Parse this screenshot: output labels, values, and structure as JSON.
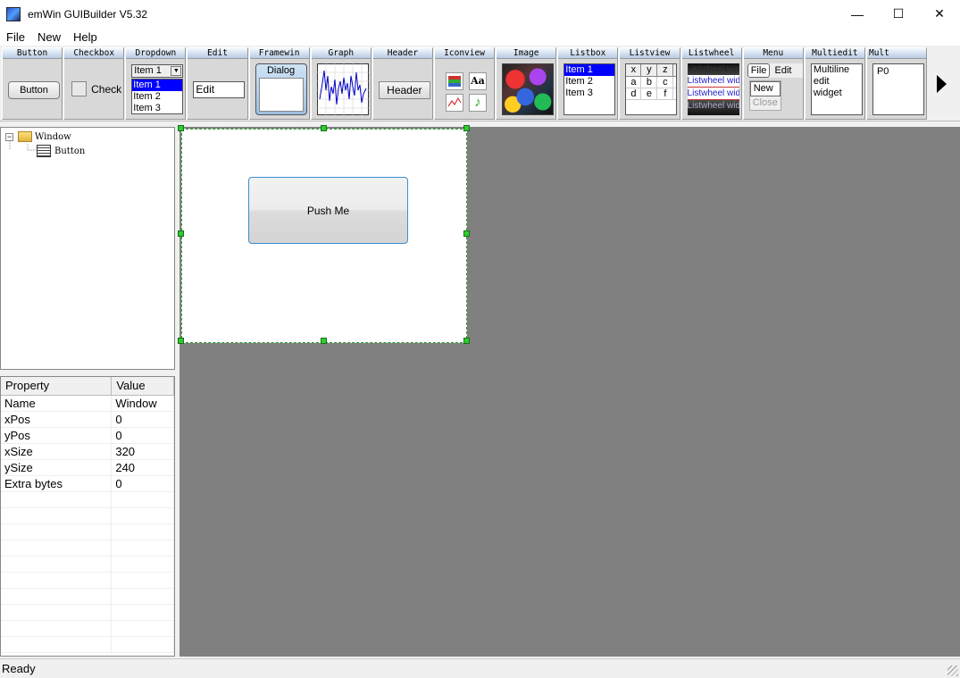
{
  "window": {
    "title": "emWin GUIBuilder V5.32",
    "controls": {
      "minimize": "—",
      "maximize": "☐",
      "close": "✕"
    }
  },
  "menubar": {
    "items": [
      "File",
      "New",
      "Help"
    ]
  },
  "palette": {
    "labels": {
      "button": "Button",
      "checkbox": "Checkbox",
      "dropdown": "Dropdown",
      "edit": "Edit",
      "framewin": "Framewin",
      "graph": "Graph",
      "header": "Header",
      "iconview": "Iconview",
      "image": "Image",
      "listbox": "Listbox",
      "listview": "Listview",
      "listwheel": "Listwheel",
      "menu": "Menu",
      "multiedit": "Multiedit",
      "multipage": "Mult"
    },
    "button_sample": "Button",
    "checkbox_sample": "Check",
    "dropdown": {
      "selected": "Item 1",
      "items": [
        "Item 1",
        "Item 2",
        "Item 3"
      ]
    },
    "edit_sample": "Edit",
    "framewin_sample": "Dialog",
    "header_sample": "Header",
    "listbox_items": [
      "Item 1",
      "Item 2",
      "Item 3"
    ],
    "listview": {
      "headers": [
        "x",
        "y",
        "z"
      ],
      "rows": [
        [
          "a",
          "b",
          "c"
        ],
        [
          "d",
          "e",
          "f"
        ]
      ]
    },
    "listwheel_items": [
      "Listwheel widget",
      "Listwheel widget",
      "Listwheel widget",
      "Listwheel widget"
    ],
    "menu": {
      "top": [
        "File",
        "Edit"
      ],
      "sub": [
        "New",
        "Close"
      ]
    },
    "multiedit_lines": [
      "Multiline",
      "edit",
      "widget"
    ],
    "multipage_tab": "P0",
    "iconview_icons": [
      "books-icon",
      "font-icon",
      "chart-icon",
      "music-note-icon"
    ]
  },
  "tree": {
    "root": "Window",
    "child": "Button"
  },
  "properties": {
    "headers": [
      "Property",
      "Value"
    ],
    "rows": [
      [
        "Name",
        "Window"
      ],
      [
        "xPos",
        "0"
      ],
      [
        "yPos",
        "0"
      ],
      [
        "xSize",
        "320"
      ],
      [
        "ySize",
        "240"
      ],
      [
        "Extra bytes",
        "0"
      ]
    ]
  },
  "design": {
    "button_label": "Push Me"
  },
  "status": {
    "text": "Ready"
  },
  "colors": {
    "selection": "#0000ff",
    "handle": "#2ccd2c",
    "workspace": "#808080"
  }
}
